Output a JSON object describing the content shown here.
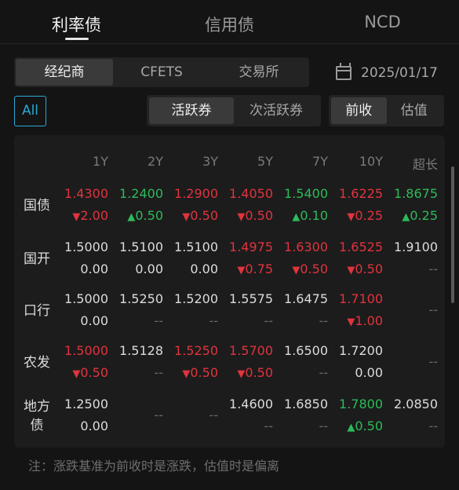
{
  "top_tabs": [
    "利率债",
    "信用债",
    "NCD"
  ],
  "filter1": {
    "options": [
      "经纪商",
      "CFETS",
      "交易所"
    ],
    "date": "2025/01/17"
  },
  "filter2": {
    "all": "All",
    "options": [
      "活跃券",
      "次活跃券"
    ],
    "mode": [
      "前收",
      "估值"
    ]
  },
  "table": {
    "columns": [
      "1Y",
      "2Y",
      "3Y",
      "5Y",
      "7Y",
      "10Y",
      "超长"
    ],
    "rows": [
      {
        "label": "国债",
        "cells": [
          {
            "yield": "1.4300",
            "chg": "2.00",
            "dir": "down",
            "ycolor": "up"
          },
          {
            "yield": "1.2400",
            "chg": "0.50",
            "dir": "up",
            "ycolor": "dn"
          },
          {
            "yield": "1.2900",
            "chg": "0.50",
            "dir": "down",
            "ycolor": "up"
          },
          {
            "yield": "1.4050",
            "chg": "0.50",
            "dir": "down",
            "ycolor": "up"
          },
          {
            "yield": "1.5400",
            "chg": "0.10",
            "dir": "up",
            "ycolor": "dn"
          },
          {
            "yield": "1.6225",
            "chg": "0.25",
            "dir": "down",
            "ycolor": "up"
          },
          {
            "yield": "1.8675",
            "chg": "0.25",
            "dir": "up",
            "ycolor": "dn"
          }
        ]
      },
      {
        "label": "国开",
        "cells": [
          {
            "yield": "1.5000",
            "chg": "0.00",
            "dir": "none",
            "ycolor": "neu"
          },
          {
            "yield": "1.5100",
            "chg": "0.00",
            "dir": "none",
            "ycolor": "neu"
          },
          {
            "yield": "1.5100",
            "chg": "0.00",
            "dir": "none",
            "ycolor": "neu"
          },
          {
            "yield": "1.4975",
            "chg": "0.75",
            "dir": "down",
            "ycolor": "up"
          },
          {
            "yield": "1.6300",
            "chg": "0.50",
            "dir": "down",
            "ycolor": "up"
          },
          {
            "yield": "1.6525",
            "chg": "0.50",
            "dir": "down",
            "ycolor": "up"
          },
          {
            "yield": "1.9100",
            "chg": "--",
            "dir": "none",
            "ycolor": "neu"
          }
        ]
      },
      {
        "label": "口行",
        "cells": [
          {
            "yield": "1.5000",
            "chg": "0.00",
            "dir": "none",
            "ycolor": "neu"
          },
          {
            "yield": "1.5250",
            "chg": "--",
            "dir": "none",
            "ycolor": "neu"
          },
          {
            "yield": "1.5200",
            "chg": "--",
            "dir": "none",
            "ycolor": "neu"
          },
          {
            "yield": "1.5575",
            "chg": "--",
            "dir": "none",
            "ycolor": "neu"
          },
          {
            "yield": "1.6475",
            "chg": "--",
            "dir": "none",
            "ycolor": "neu"
          },
          {
            "yield": "1.7100",
            "chg": "1.00",
            "dir": "down",
            "ycolor": "up"
          },
          {
            "yield": "--",
            "chg": "",
            "dir": "none",
            "ycolor": "dash",
            "center": true
          }
        ]
      },
      {
        "label": "农发",
        "cells": [
          {
            "yield": "1.5000",
            "chg": "0.50",
            "dir": "down",
            "ycolor": "up"
          },
          {
            "yield": "1.5128",
            "chg": "--",
            "dir": "none",
            "ycolor": "neu"
          },
          {
            "yield": "1.5250",
            "chg": "0.50",
            "dir": "down",
            "ycolor": "up"
          },
          {
            "yield": "1.5700",
            "chg": "0.50",
            "dir": "down",
            "ycolor": "up"
          },
          {
            "yield": "1.6500",
            "chg": "--",
            "dir": "none",
            "ycolor": "neu"
          },
          {
            "yield": "1.7200",
            "chg": "0.00",
            "dir": "none",
            "ycolor": "neu"
          },
          {
            "yield": "--",
            "chg": "",
            "dir": "none",
            "ycolor": "dash",
            "center": true
          }
        ]
      },
      {
        "label": "地方债",
        "cells": [
          {
            "yield": "1.2500",
            "chg": "0.00",
            "dir": "none",
            "ycolor": "neu"
          },
          {
            "yield": "--",
            "chg": "",
            "dir": "none",
            "ycolor": "dash",
            "center": true
          },
          {
            "yield": "--",
            "chg": "",
            "dir": "none",
            "ycolor": "dash",
            "center": true
          },
          {
            "yield": "1.4600",
            "chg": "--",
            "dir": "none",
            "ycolor": "neu"
          },
          {
            "yield": "1.6850",
            "chg": "--",
            "dir": "none",
            "ycolor": "neu"
          },
          {
            "yield": "1.7800",
            "chg": "0.50",
            "dir": "up",
            "ycolor": "dn"
          },
          {
            "yield": "2.0850",
            "chg": "--",
            "dir": "none",
            "ycolor": "neu"
          }
        ]
      }
    ]
  },
  "note": "注：涨跌基准为前收时是涨跌，估值时是偏离",
  "colors": {
    "up": "#e0343e",
    "down": "#2dbb5a",
    "accent": "#29a9d6"
  },
  "icons": {
    "calendar": "calendar-icon"
  }
}
